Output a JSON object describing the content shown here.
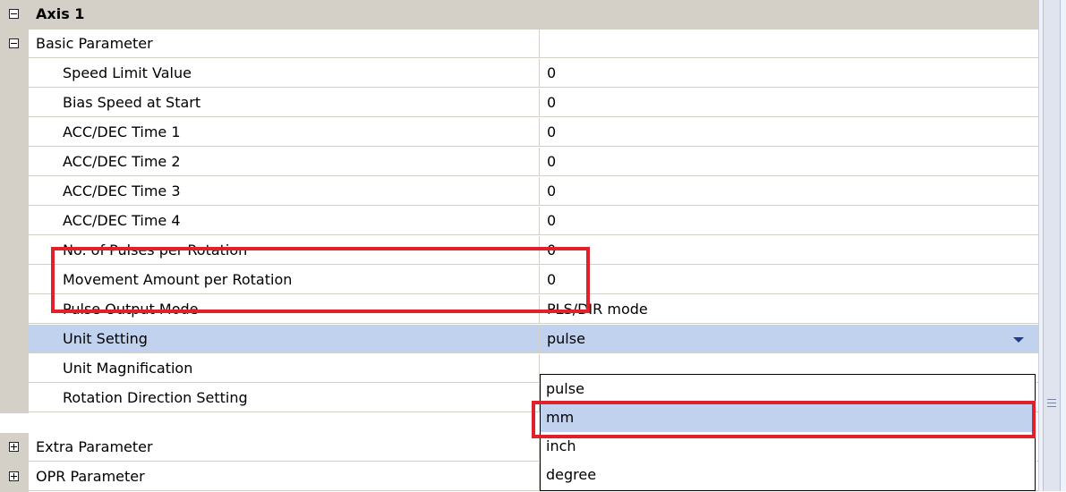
{
  "header": {
    "title": "Axis 1"
  },
  "basic_parameter": {
    "label": "Basic Parameter",
    "rows": [
      {
        "name": "Speed Limit Value",
        "value": "0"
      },
      {
        "name": "Bias Speed at Start",
        "value": "0"
      },
      {
        "name": "ACC/DEC Time 1",
        "value": "0"
      },
      {
        "name": "ACC/DEC Time 2",
        "value": "0"
      },
      {
        "name": "ACC/DEC Time 3",
        "value": "0"
      },
      {
        "name": "ACC/DEC Time 4",
        "value": "0"
      },
      {
        "name": "No. of Pulses per Rotation",
        "value": "0"
      },
      {
        "name": "Movement Amount per Rotation",
        "value": "0"
      },
      {
        "name": "Pulse Output Mode",
        "value": "PLS/DIR mode"
      },
      {
        "name": "Unit Setting",
        "value": "pulse"
      },
      {
        "name": "Unit Magnification",
        "value": ""
      },
      {
        "name": "Rotation Direction Setting",
        "value": ""
      }
    ]
  },
  "categories": {
    "extra": "Extra Parameter",
    "opr": "OPR Parameter"
  },
  "dropdown": {
    "options": [
      "pulse",
      "mm",
      "inch",
      "degree"
    ],
    "highlighted": "mm"
  },
  "colors": {
    "highlight_box": "#e0202a",
    "selection": "#c1d2ee",
    "gutter": "#d4d0c8"
  }
}
